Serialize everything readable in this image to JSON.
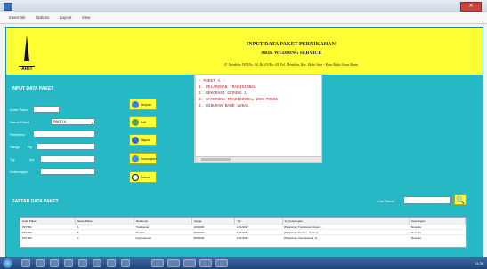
{
  "window": {
    "menu": [
      "Insert Ink",
      "Options",
      "Layout",
      "View"
    ],
    "close_icon": "close-icon"
  },
  "header": {
    "line1": "INPUT DATA PAKET PERNIKAHAN",
    "line2": "ARIE WEDDING SERVICE",
    "line3": "Jl. Merdeka VIII No. 44, Rt. 03/Rw. 05 Kel. Merdeka, Kec. Bukit Sari - Kota Bukit Jawa Barat",
    "logo_text": "ARTI",
    "color": "#ffff33"
  },
  "form": {
    "title": "INPUT DATA PAKET",
    "fields": [
      {
        "label": "Kode Paket",
        "value": ""
      },
      {
        "label": "Nama Paket",
        "value": "PAKET A"
      },
      {
        "label": "Referensi",
        "value": ""
      },
      {
        "label": "Harga",
        "value": ""
      },
      {
        "label": "Tgl",
        "value": ""
      },
      {
        "label": "Keterangan",
        "value": ""
      }
    ],
    "field_extra": {
      "harga_suffix": "Rp",
      "tgl_suffix": "s/d"
    }
  },
  "buttons": [
    {
      "label": "Simpan",
      "icon": "save-icon"
    },
    {
      "label": "Edit",
      "icon": "edit-icon"
    },
    {
      "label": "Hapus",
      "icon": "delete-icon"
    },
    {
      "label": "Kosongkan",
      "icon": "reset-icon"
    },
    {
      "label": "Keluar",
      "icon": "exit-icon"
    }
  ],
  "textarea": {
    "lines": [
      "- PAKET A -",
      "1. PELAMINAN TRADISIONAL",
      "2. DEKORASI GEDUNG 1",
      "3. CATERING TRADISIONAL 200 PORSI",
      "4. HIBURAN BAND LOKAL"
    ]
  },
  "table_section": {
    "title": "DAFTAR DATA PAKET",
    "search_label": "Cari Paket",
    "search_value": "",
    "search_icon": "search-icon"
  },
  "table": {
    "columns": [
      "Kode Paket",
      "Nama Paket",
      "Referensi",
      "Harga",
      "Tgl",
      "Isi_Keterangan",
      "Keterangan"
    ],
    "rows": [
      [
        "PKT001",
        "A",
        "Tradisional",
        "2000000",
        "1/01/2013",
        "[Pelaminan Tradisional, Dekor...",
        "Tersedia"
      ],
      [
        "PKT002",
        "B",
        "Modern",
        "3000000",
        "1/01/2013",
        "[Pelaminan Modern, Gedung...",
        "Tersedia"
      ],
      [
        "PKT003",
        "C",
        "Internasional",
        "5000000",
        "1/01/2013",
        "[Pelaminan Internasional, G...",
        "Tersedia"
      ]
    ]
  },
  "taskbar": {
    "clock": "11:30"
  }
}
